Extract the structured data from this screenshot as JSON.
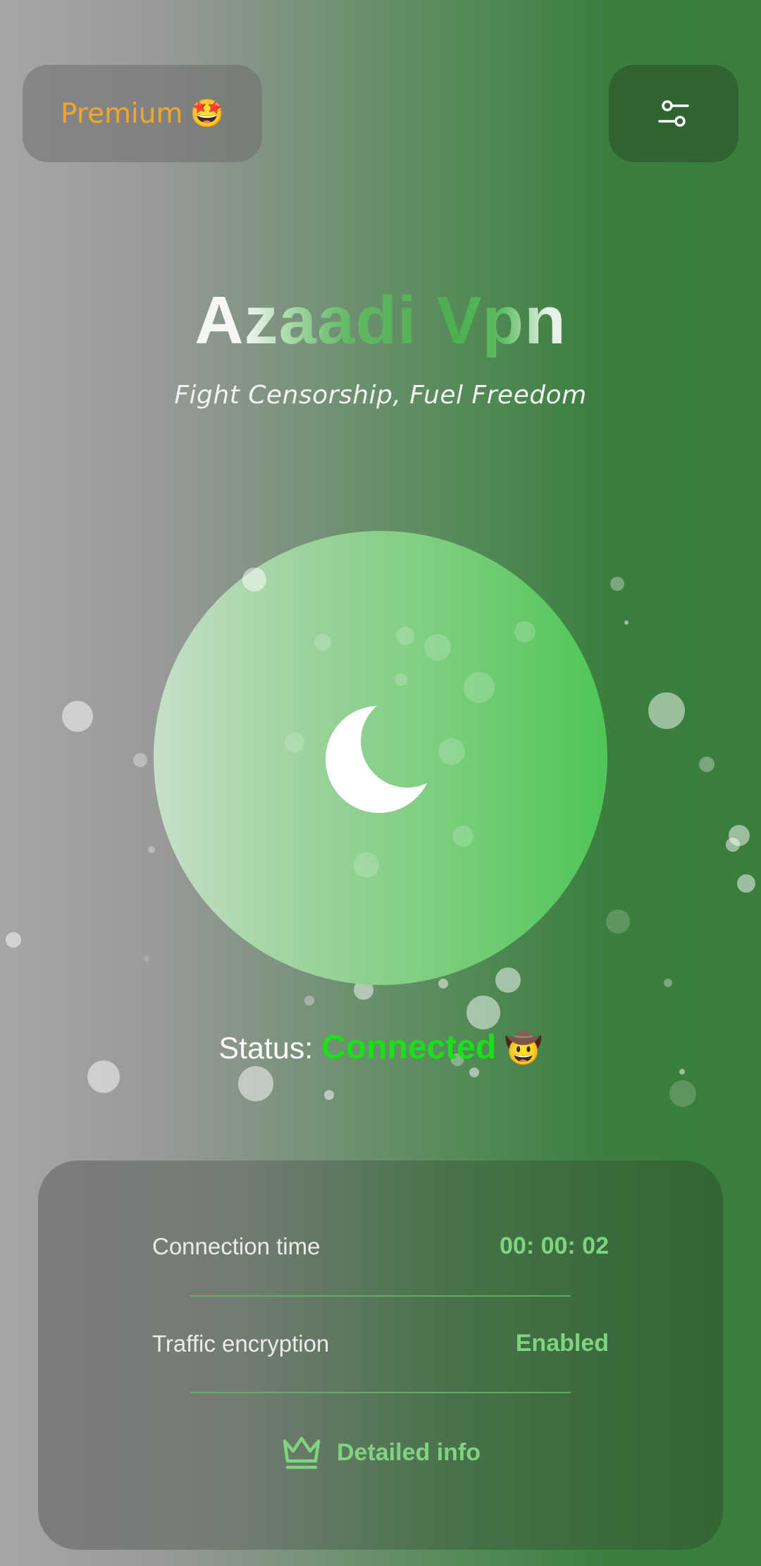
{
  "header": {
    "premium_label": "Premium",
    "premium_emoji": "🤩",
    "settings_icon": "sliders-icon"
  },
  "app": {
    "title": "Azaadi Vpn",
    "subtitle": "Fight Censorship, Fuel Freedom"
  },
  "power_button": {
    "icon": "moon-icon"
  },
  "status": {
    "label": "Status: ",
    "value": "Connected",
    "emoji": "🤠"
  },
  "info": {
    "rows": [
      {
        "label": "Connection time",
        "value": "00: 00: 02"
      },
      {
        "label": "Traffic encryption",
        "value": "Enabled"
      }
    ],
    "detail_label": "Detailed info",
    "detail_icon": "crown-icon"
  },
  "colors": {
    "accent_green": "#7fd47f",
    "status_green": "#19e019",
    "premium_orange": "#f5a623"
  }
}
